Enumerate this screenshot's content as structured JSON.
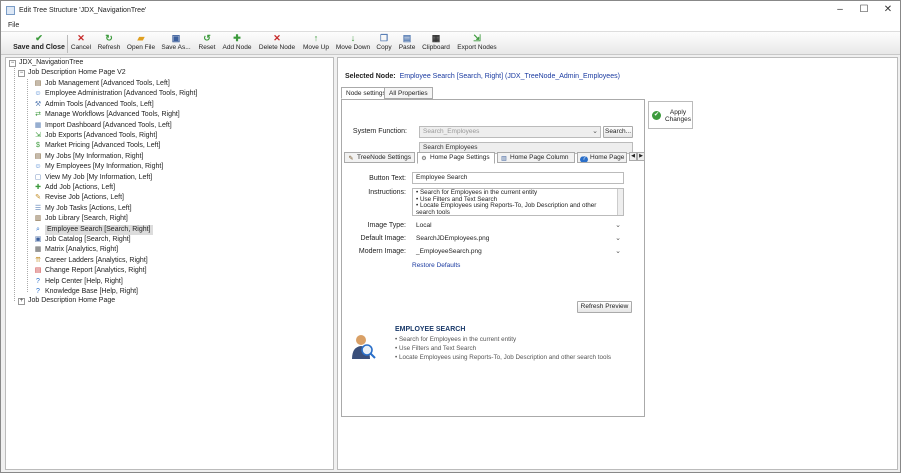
{
  "window": {
    "title": "Edit Tree Structure 'JDX_NavigationTree'"
  },
  "menu": {
    "file": "File"
  },
  "toolbar": {
    "save_close": "Save and Close",
    "cancel": "Cancel",
    "refresh": "Refresh",
    "open_file": "Open File",
    "save_as": "Save As...",
    "reset": "Reset",
    "add_node": "Add Node",
    "delete_node": "Delete Node",
    "move_up": "Move Up",
    "move_down": "Move Down",
    "copy": "Copy",
    "paste": "Paste",
    "clipboard": "Clipboard",
    "export_nodes": "Export Nodes"
  },
  "tree": {
    "root": "JDX_NavigationTree",
    "group1": "Job Description Home Page V2",
    "items": [
      "Job Management [Advanced Tools, Left]",
      "Employee Administration [Advanced Tools, Right]",
      "Admin Tools [Advanced Tools, Left]",
      "Manage Workflows [Advanced Tools, Right]",
      "Import Dashboard [Advanced Tools, Left]",
      "Job Exports [Advanced Tools, Right]",
      "Market Pricing [Advanced Tools, Left]",
      "My Jobs [My Information, Right]",
      "My Employees [My Information, Right]",
      "View My Job [My Information, Left]",
      "Add Job [Actions, Left]",
      "Revise Job [Actions, Left]",
      "My Job Tasks [Actions, Left]",
      "Job Library [Search, Right]",
      "Employee Search [Search, Right]",
      "Job Catalog [Search, Right]",
      "Matrix [Analytics, Right]",
      "Career Ladders [Analytics, Right]",
      "Change Report [Analytics, Right]",
      "Help Center [Help, Right]",
      "Knowledge Base [Help, Right]"
    ],
    "group2": "Job Description Home Page"
  },
  "right": {
    "selected_label": "Selected Node:",
    "selected_value": "Employee Search [Search, Right]  (JDX_TreeNode_Admin_Employees)",
    "tab_node_settings": "Node settings",
    "tab_all_properties": "All Properties",
    "system_function_label": "System Function:",
    "system_function_value": "Search_Employees",
    "search_btn": "Search...",
    "system_function_desc": "Search Employees",
    "apply_changes": "Apply Changes",
    "subtab_treenode": "TreeNode Settings",
    "subtab_homepage": "Home Page Settings",
    "subtab_column": "Home Page Column",
    "subtab_homepage2": "Home Page",
    "button_text_label": "Button Text:",
    "button_text_value": "Employee Search",
    "instructions_label": "Instructions:",
    "instructions_lines": [
      "• Search for Employees in the current entity",
      "• Use Filters and Text Search",
      "• Locate Employees using Reports-To, Job Description and other",
      "search tools"
    ],
    "image_type_label": "Image Type:",
    "image_type_value": "Local",
    "default_image_label": "Default Image:",
    "default_image_value": "SearchJDEmployees.png",
    "modern_image_label": "Modern Image:",
    "modern_image_value": "_EmployeeSearch.png",
    "restore_defaults": "Restore Defaults",
    "refresh_preview": "Refresh Preview",
    "preview_title": "EMPLOYEE SEARCH",
    "preview_lines": [
      "• Search for Employees in the current entity",
      "• Use Filters and Text Search",
      "• Locate Employees using Reports-To, Job Description and other search tools"
    ]
  },
  "colors": {
    "link": "#1a3aa0",
    "accent_green": "#3c9a3c",
    "delete_red": "#c62828"
  }
}
